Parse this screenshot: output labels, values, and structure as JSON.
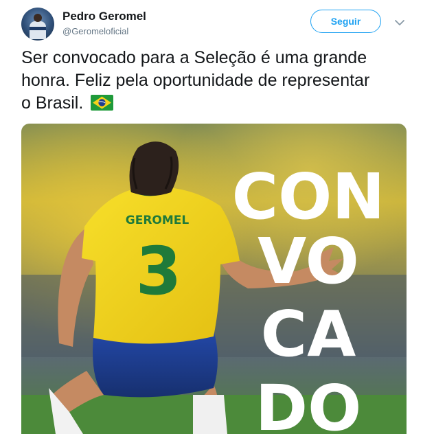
{
  "author": {
    "name": "Pedro Geromel",
    "handle": "@Geromeloficial"
  },
  "actions": {
    "follow_label": "Seguir"
  },
  "tweet": {
    "text_line1": "Ser convocado para a Seleção é uma grande",
    "text_line2": "honra. Feliz pela oportunidade de representar",
    "text_line3": "o Brasil.",
    "flag_emoji": "brazil-flag-icon"
  },
  "media": {
    "jersey_name": "GEROMEL",
    "jersey_number": "3",
    "headline_lines": [
      "CON",
      "VO",
      "CA",
      "DO"
    ]
  },
  "colors": {
    "accent": "#1da1f2",
    "text_primary": "#14171a",
    "text_secondary": "#657786",
    "jersey_yellow": "#f2d21b",
    "jersey_green": "#1f7a3a",
    "shorts_blue": "#1e3f9b"
  }
}
